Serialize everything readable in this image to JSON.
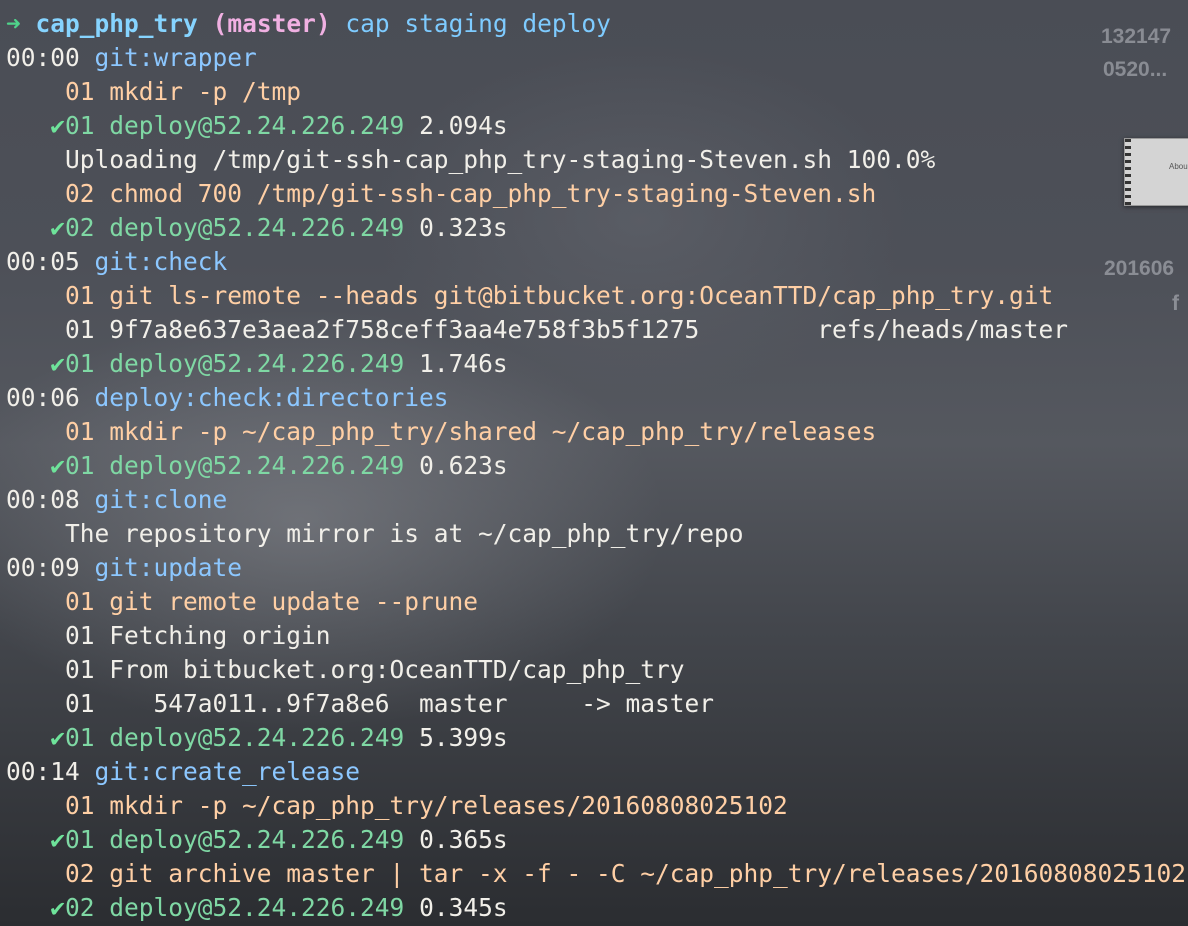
{
  "desktop": {
    "labels": [
      "132147",
      "0520...",
      "201606",
      "f"
    ],
    "thumbnail_text": "Abou"
  },
  "prompt": {
    "arrow": "➜",
    "cwd": "cap_php_try",
    "branch": "(master)",
    "command": "cap staging deploy"
  },
  "lines": [
    {
      "kind": "task",
      "time": "00:00",
      "text": "git:wrapper"
    },
    {
      "kind": "cmd",
      "text": "01 mkdir -p /tmp"
    },
    {
      "kind": "ok",
      "check": "✔",
      "text": "01 deploy@52.24.226.249",
      "dur": "2.094s"
    },
    {
      "kind": "out",
      "text": "Uploading /tmp/git-ssh-cap_php_try-staging-Steven.sh 100.0%"
    },
    {
      "kind": "cmd",
      "text": "02 chmod 700 /tmp/git-ssh-cap_php_try-staging-Steven.sh"
    },
    {
      "kind": "ok",
      "check": "✔",
      "text": "02 deploy@52.24.226.249",
      "dur": "0.323s"
    },
    {
      "kind": "task",
      "time": "00:05",
      "text": "git:check"
    },
    {
      "kind": "cmd",
      "text": "01 git ls-remote --heads git@bitbucket.org:OceanTTD/cap_php_try.git"
    },
    {
      "kind": "out",
      "text": "01 9f7a8e637e3aea2f758ceff3aa4e758f3b5f1275        refs/heads/master"
    },
    {
      "kind": "ok",
      "check": "✔",
      "text": "01 deploy@52.24.226.249",
      "dur": "1.746s"
    },
    {
      "kind": "task",
      "time": "00:06",
      "text": "deploy:check:directories"
    },
    {
      "kind": "cmd",
      "text": "01 mkdir -p ~/cap_php_try/shared ~/cap_php_try/releases"
    },
    {
      "kind": "ok",
      "check": "✔",
      "text": "01 deploy@52.24.226.249",
      "dur": "0.623s"
    },
    {
      "kind": "task",
      "time": "00:08",
      "text": "git:clone"
    },
    {
      "kind": "out",
      "text": "The repository mirror is at ~/cap_php_try/repo"
    },
    {
      "kind": "task",
      "time": "00:09",
      "text": "git:update"
    },
    {
      "kind": "cmd",
      "text": "01 git remote update --prune"
    },
    {
      "kind": "out",
      "text": "01 Fetching origin"
    },
    {
      "kind": "out",
      "text": "01 From bitbucket.org:OceanTTD/cap_php_try"
    },
    {
      "kind": "out",
      "text": "01    547a011..9f7a8e6  master     -> master"
    },
    {
      "kind": "ok",
      "check": "✔",
      "text": "01 deploy@52.24.226.249",
      "dur": "5.399s"
    },
    {
      "kind": "task",
      "time": "00:14",
      "text": "git:create_release"
    },
    {
      "kind": "cmd",
      "text": "01 mkdir -p ~/cap_php_try/releases/20160808025102"
    },
    {
      "kind": "ok",
      "check": "✔",
      "text": "01 deploy@52.24.226.249",
      "dur": "0.365s"
    },
    {
      "kind": "cmd",
      "text": "02 git archive master | tar -x -f - -C ~/cap_php_try/releases/20160808025102"
    },
    {
      "kind": "ok",
      "check": "✔",
      "text": "02 deploy@52.24.226.249",
      "dur": "0.345s"
    }
  ]
}
